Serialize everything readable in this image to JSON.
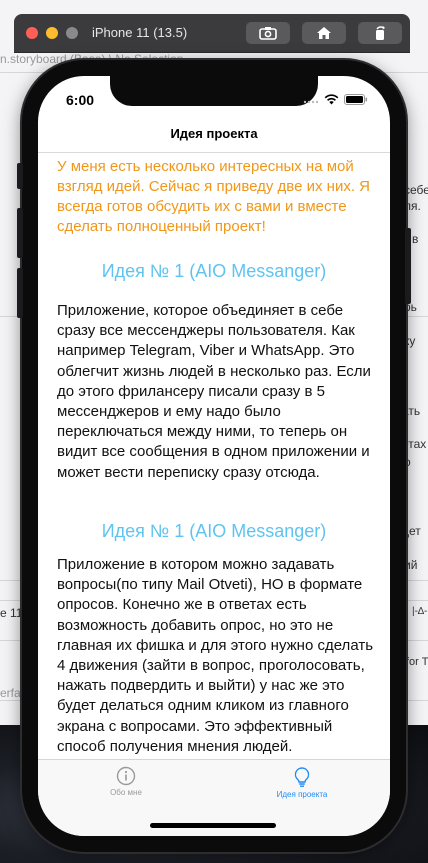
{
  "simulator": {
    "title": "iPhone 11 (13.5)",
    "colors": {
      "close": "#ff5f57",
      "minimize": "#febc2e",
      "zoom": "#8a8a8a"
    },
    "buttons": [
      "screenshot-icon",
      "home-icon",
      "rotate-icon"
    ]
  },
  "background": {
    "storyboard_path": "n.storyboard (Base) \\ No Selection",
    "right_fragments": [
      "себе",
      "ля.",
      "й в",
      "рь",
      "ку",
      "ать",
      "етах",
      "о",
      "дет",
      "ий"
    ],
    "left_fragments": [
      "e 11",
      "erfac"
    ],
    "bottom_right": [
      "|-∆-",
      "for T"
    ]
  },
  "status_bar": {
    "time": "6:00"
  },
  "nav": {
    "title": "Идея проекта"
  },
  "intro": "У меня есть несколько интересных на мой взгляд идей. Сейчас я приведу две их них. Я всегда готов обсудить их с вами и вместе сделать полноценный проект!",
  "ideas": [
    {
      "title": "Идея № 1 (AIO Messanger)",
      "body": "Приложение, которое объединяет в себе сразу все мессенджеры пользователя. Как например Telegram, Viber и WhatsApp. Это облегчит жизнь людей в несколько раз. Если до этого фрилансеру писали сразу в 5 мессенджеров и ему надо было переключаться между ними, то теперь он видит все сообщения в одном приложении и может вести переписку сразу отсюда."
    },
    {
      "title": "Идея № 1 (AIO Messanger)",
      "body": "Приложение в котором можно задавать вопросы(по типу Mail Otveti), НО в формате опросов. Конечно же в ответах есть возможность добавить опрос, но это не главная их фишка и для этого нужно сделать 4 движения (зайти в вопрос, проголосовать, нажать подвердить и выйти) у нас же это будет делаться одним кликом из главного экрана с вопросами. Это эффективный способ получения мнения людей."
    }
  ],
  "tabs": [
    {
      "label": "Обо мне",
      "icon": "info-icon",
      "selected": false
    },
    {
      "label": "Идея проекта",
      "icon": "lightbulb-icon",
      "selected": true
    }
  ],
  "colors": {
    "intro": "#f0971a",
    "idea_title": "#5fc3f0",
    "tab_selected": "#1e8cf5",
    "tab_unselected": "#9a9a9a"
  }
}
